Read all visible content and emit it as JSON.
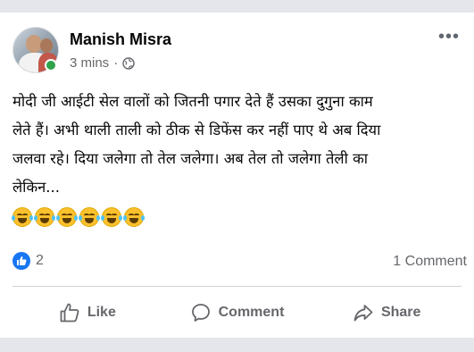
{
  "post": {
    "author": "Manish Misra",
    "time": "3 mins",
    "separator": "·",
    "privacy_icon": "globe-icon",
    "more_icon": "more-options-icon",
    "text": "मोदी जी आईटी सेल वालों को जितनी पगार देते हैं उसका दुगुना काम\nलेते हैं। अभी थाली ताली को ठीक से डिफेंस कर नहीं पाए थे अब दिया\nजलवा रहे। दिया जलेगा तो तेल जलेगा। अब तेल तो जलेगा तेली का\nलेकिन...",
    "emoji_count": 6,
    "emoji_name": "laughing-crying-emoji"
  },
  "stats": {
    "likes": "2",
    "comments": "1 Comment"
  },
  "actions": {
    "like_label": "Like",
    "comment_label": "Comment",
    "share_label": "Share"
  },
  "colors": {
    "background": "#e4e6eb",
    "card": "#ffffff",
    "brand_blue": "#1877f2",
    "online_green": "#31a24c",
    "secondary_text": "#65676b"
  }
}
